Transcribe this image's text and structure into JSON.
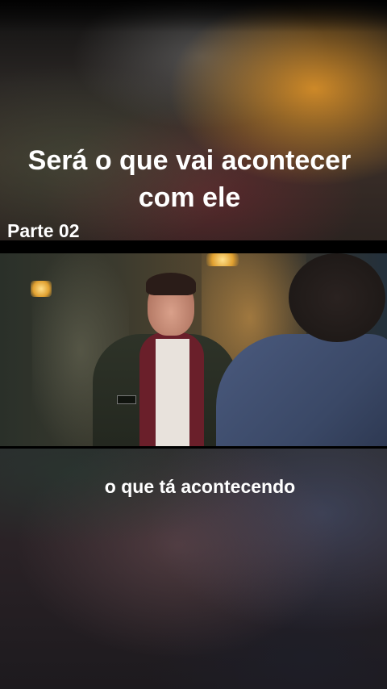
{
  "overlay": {
    "title": "Será o que vai acontecer\ncom ele",
    "part_label": "Parte 02"
  },
  "video": {
    "caption": "o que tá acontecendo"
  }
}
